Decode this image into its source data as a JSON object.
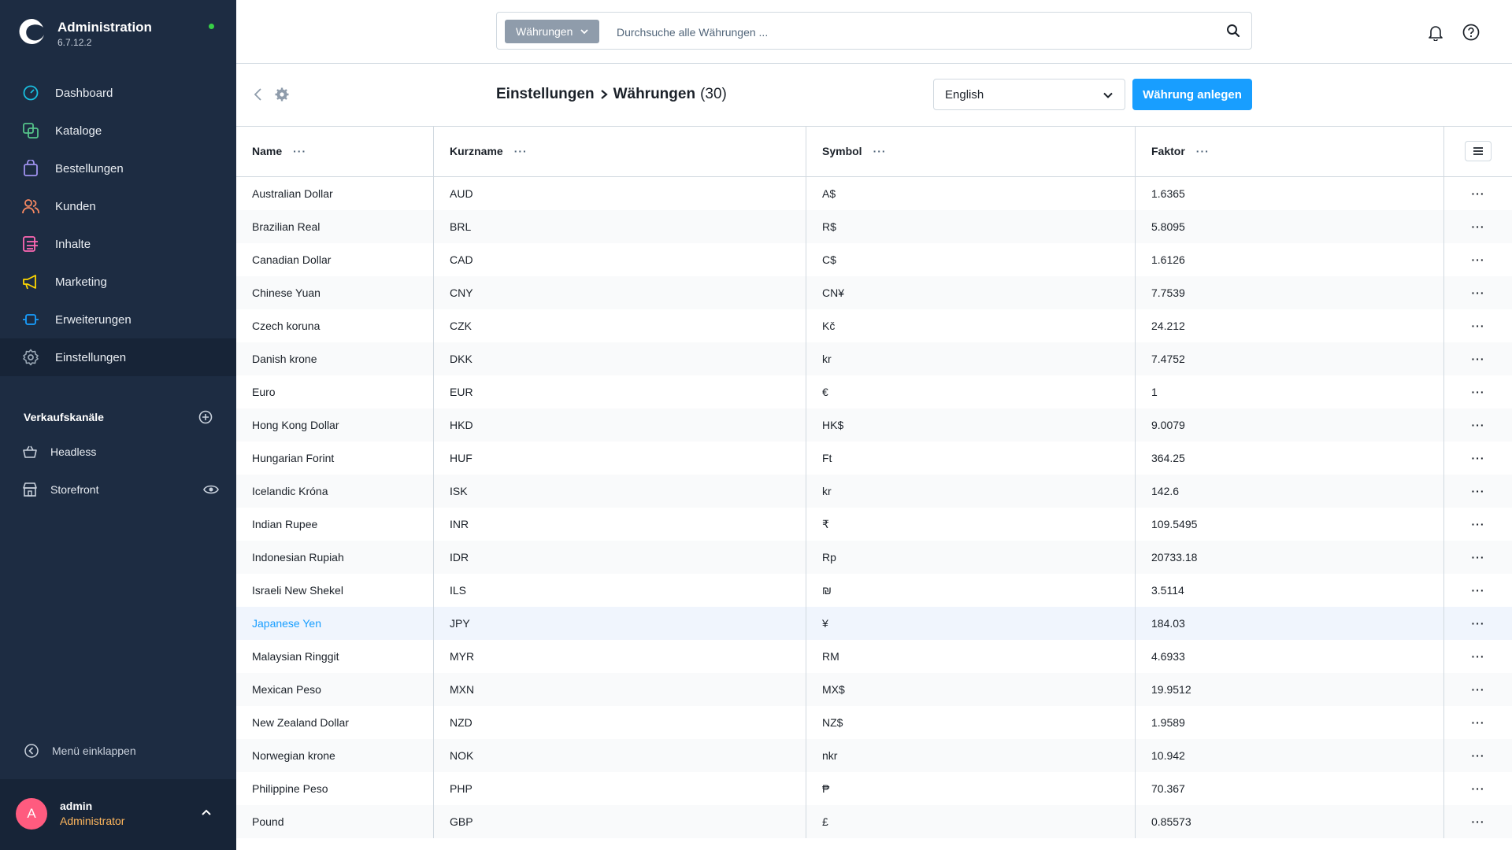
{
  "app": {
    "title": "Administration",
    "version": "6.7.12.2",
    "status_color": "#37d046"
  },
  "sidebar": {
    "items": [
      {
        "label": "Dashboard",
        "icon": "dashboard-icon",
        "color": "#19bfe0"
      },
      {
        "label": "Kataloge",
        "icon": "catalog-icon",
        "color": "#55c48a"
      },
      {
        "label": "Bestellungen",
        "icon": "orders-icon",
        "color": "#a092f0"
      },
      {
        "label": "Kunden",
        "icon": "customers-icon",
        "color": "#f88962"
      },
      {
        "label": "Inhalte",
        "icon": "content-icon",
        "color": "#ff68b4"
      },
      {
        "label": "Marketing",
        "icon": "marketing-icon",
        "color": "#ffd700"
      },
      {
        "label": "Erweiterungen",
        "icon": "extensions-icon",
        "color": "#189eff"
      },
      {
        "label": "Einstellungen",
        "icon": "settings-icon",
        "color": "#9aa8b5",
        "active": true
      }
    ],
    "sales_channels_title": "Verkaufskanäle",
    "sales_channels": [
      {
        "label": "Headless",
        "icon": "basket-icon"
      },
      {
        "label": "Storefront",
        "icon": "storefront-icon"
      }
    ],
    "collapse_label": "Menü einklappen",
    "user": {
      "initial": "A",
      "name": "admin",
      "role": "Administrator"
    }
  },
  "topbar": {
    "search_type": "Währungen",
    "search_placeholder": "Durchsuche alle Währungen ..."
  },
  "smartbar": {
    "breadcrumb_parent": "Einstellungen",
    "breadcrumb_current": "Währungen",
    "count": "(30)",
    "language": "English",
    "create_button": "Währung anlegen"
  },
  "grid": {
    "columns": {
      "name": "Name",
      "short": "Kurzname",
      "symbol": "Symbol",
      "factor": "Faktor"
    },
    "dots": "···",
    "rows": [
      {
        "name": "Australian Dollar",
        "short": "AUD",
        "symbol": "A$",
        "factor": "1.6365"
      },
      {
        "name": "Brazilian Real",
        "short": "BRL",
        "symbol": "R$",
        "factor": "5.8095"
      },
      {
        "name": "Canadian Dollar",
        "short": "CAD",
        "symbol": "C$",
        "factor": "1.6126"
      },
      {
        "name": "Chinese Yuan",
        "short": "CNY",
        "symbol": "CN¥",
        "factor": "7.7539"
      },
      {
        "name": "Czech koruna",
        "short": "CZK",
        "symbol": "Kč",
        "factor": "24.212"
      },
      {
        "name": "Danish krone",
        "short": "DKK",
        "symbol": "kr",
        "factor": "7.4752"
      },
      {
        "name": "Euro",
        "short": "EUR",
        "symbol": "€",
        "factor": "1"
      },
      {
        "name": "Hong Kong Dollar",
        "short": "HKD",
        "symbol": "HK$",
        "factor": "9.0079"
      },
      {
        "name": "Hungarian Forint",
        "short": "HUF",
        "symbol": "Ft",
        "factor": "364.25"
      },
      {
        "name": "Icelandic Króna",
        "short": "ISK",
        "symbol": "kr",
        "factor": "142.6"
      },
      {
        "name": "Indian Rupee",
        "short": "INR",
        "symbol": "₹",
        "factor": "109.5495"
      },
      {
        "name": "Indonesian Rupiah",
        "short": "IDR",
        "symbol": "Rp",
        "factor": "20733.18"
      },
      {
        "name": "Israeli New Shekel",
        "short": "ILS",
        "symbol": "₪",
        "factor": "3.5114"
      },
      {
        "name": "Japanese Yen",
        "short": "JPY",
        "symbol": "¥",
        "factor": "184.03",
        "highlight": true
      },
      {
        "name": "Malaysian Ringgit",
        "short": "MYR",
        "symbol": "RM",
        "factor": "4.6933"
      },
      {
        "name": "Mexican Peso",
        "short": "MXN",
        "symbol": "MX$",
        "factor": "19.9512"
      },
      {
        "name": "New Zealand Dollar",
        "short": "NZD",
        "symbol": "NZ$",
        "factor": "1.9589"
      },
      {
        "name": "Norwegian krone",
        "short": "NOK",
        "symbol": "nkr",
        "factor": "10.942"
      },
      {
        "name": "Philippine Peso",
        "short": "PHP",
        "symbol": "₱",
        "factor": "70.367"
      },
      {
        "name": "Pound",
        "short": "GBP",
        "symbol": "£",
        "factor": "0.85573"
      }
    ]
  }
}
